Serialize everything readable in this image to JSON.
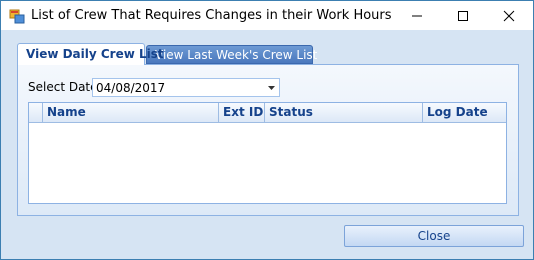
{
  "window": {
    "title": "List of Crew That Requires Changes in their Work Hours",
    "controls": {
      "minimize": "minimize",
      "maximize": "maximize",
      "close": "close"
    }
  },
  "tabs": [
    {
      "label": "View Daily Crew List",
      "active": true
    },
    {
      "label": "View Last Week's Crew List",
      "active": false
    }
  ],
  "filter": {
    "select_date_label": "Select Date:",
    "date_value": "04/08/2017"
  },
  "grid": {
    "columns": [
      "Name",
      "Ext ID",
      "Status",
      "Log Date"
    ],
    "rows": []
  },
  "footer": {
    "close_label": "Close"
  },
  "colors": {
    "accent": "#15428b",
    "border": "#8db2e3",
    "inactive_tab": "#4a78bd"
  },
  "icons": {
    "app": "app-window-icon",
    "combo": "chevron-down-icon"
  }
}
